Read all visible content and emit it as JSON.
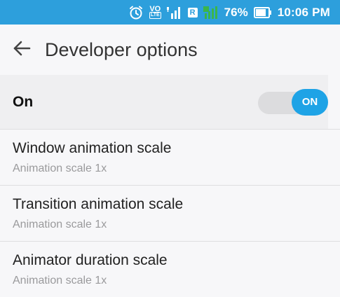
{
  "status_bar": {
    "alarm_icon": "alarm-clock-icon",
    "volte": {
      "top": "VO",
      "bottom": "LTE"
    },
    "roaming_label": "R",
    "battery_percent": "76%",
    "time": "10:06 PM",
    "accent": "#2d9fdc"
  },
  "app_bar": {
    "back_icon": "arrow-left-icon",
    "title": "Developer options"
  },
  "master_switch": {
    "label": "On",
    "toggle_label": "ON",
    "checked": true,
    "accent": "#1ea3e6"
  },
  "settings": [
    {
      "title": "Window animation scale",
      "summary": "Animation scale 1x"
    },
    {
      "title": "Transition animation scale",
      "summary": "Animation scale 1x"
    },
    {
      "title": "Animator duration scale",
      "summary": "Animation scale 1x"
    }
  ]
}
